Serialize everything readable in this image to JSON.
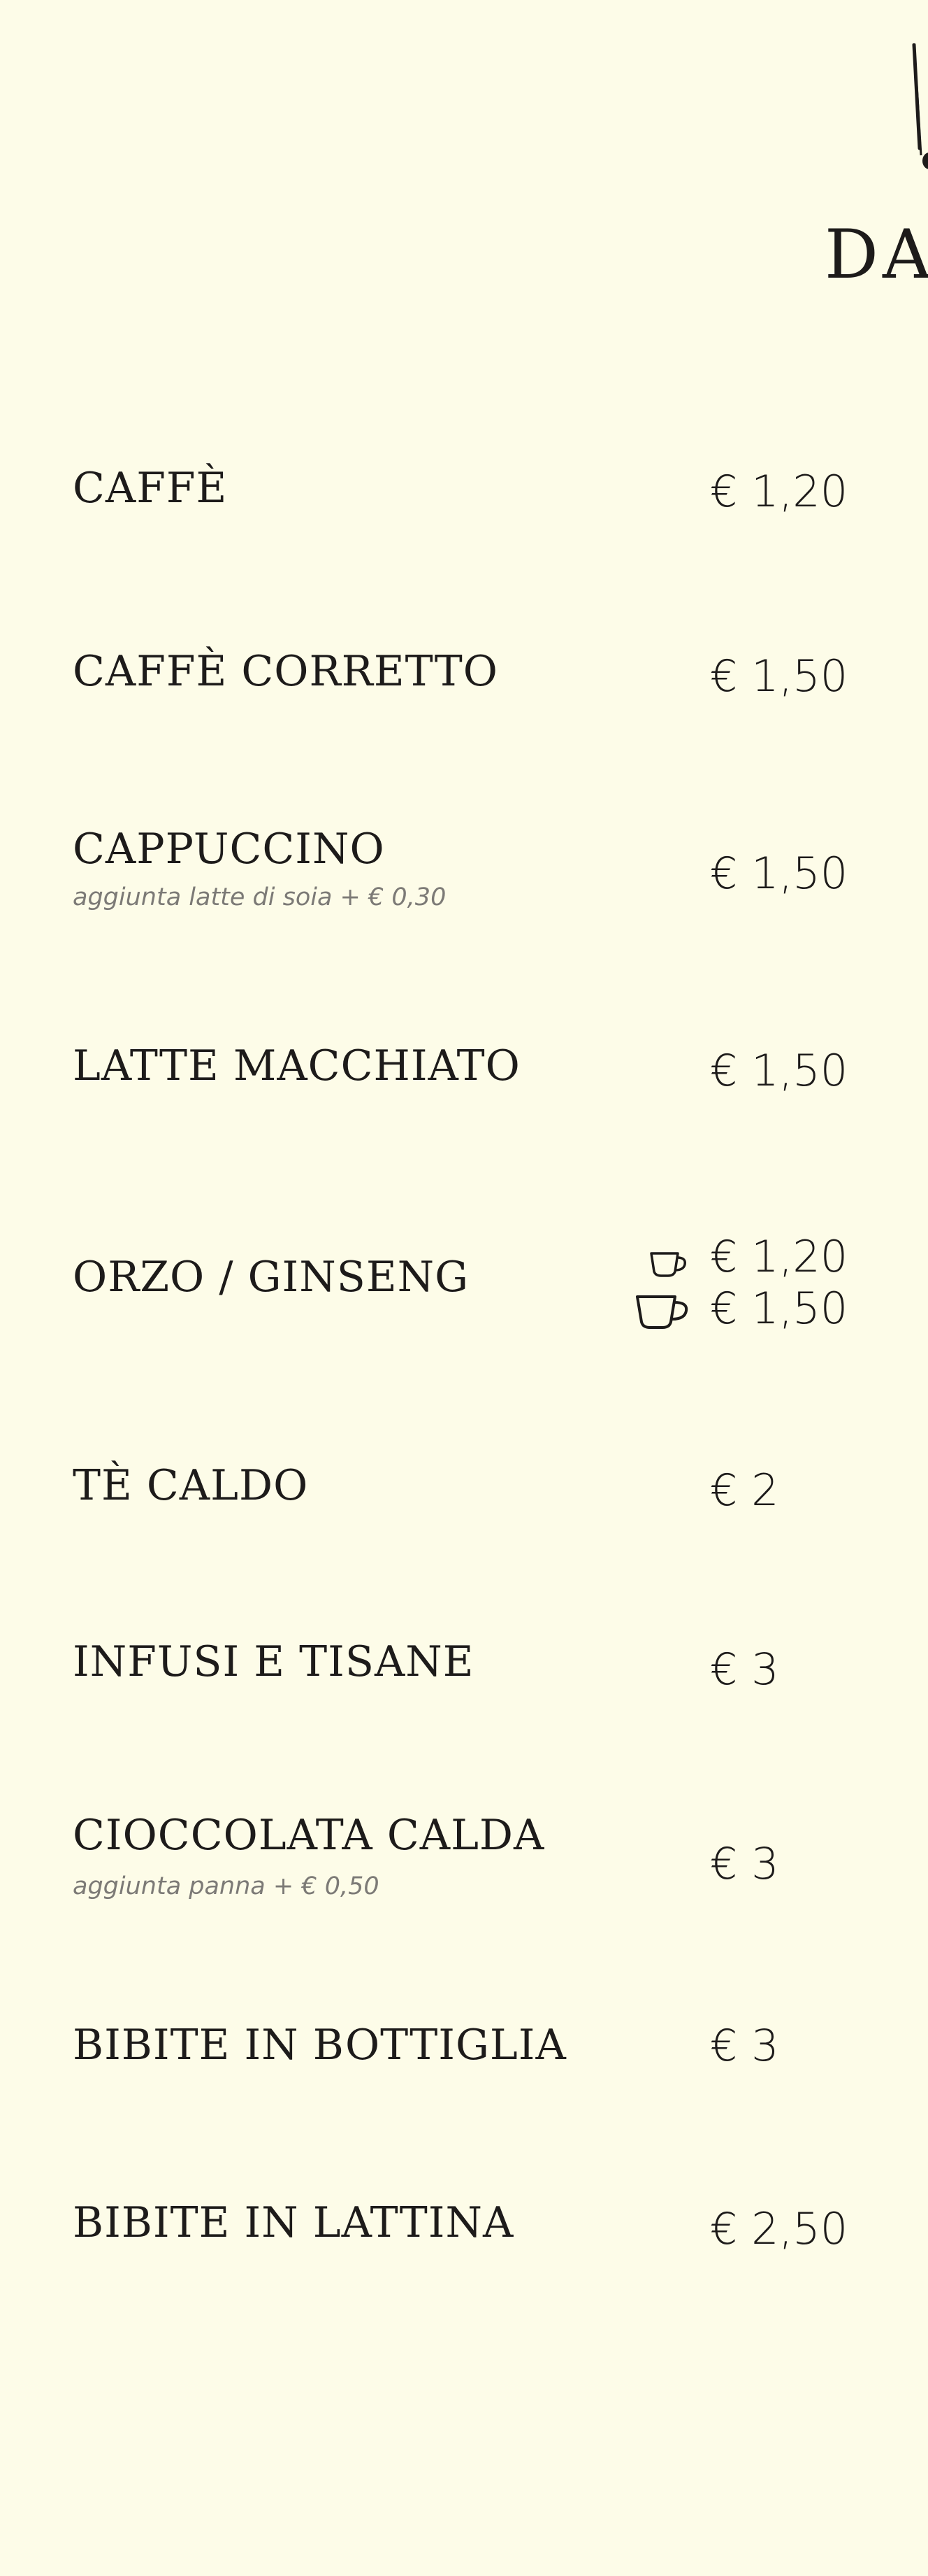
{
  "menu": {
    "section_title": "DA",
    "items": [
      {
        "name": "CAFFÈ",
        "note": "",
        "price": "€ 1,20"
      },
      {
        "name": "CAFFÈ CORRETTO",
        "note": "",
        "price": "€ 1,50"
      },
      {
        "name": "CAPPUCCINO",
        "note": "aggiunta latte di soia + € 0,30",
        "price": "€ 1,50"
      },
      {
        "name": "LATTE MACCHIATO",
        "note": "",
        "price": "€ 1,50"
      },
      {
        "name": "ORZO / GINSENG",
        "note": "",
        "price_small": "€ 1,20",
        "price_large": "€ 1,50",
        "small_icon": "small-cup-icon",
        "large_icon": "large-cup-icon"
      },
      {
        "name": "TÈ CALDO",
        "note": "",
        "price": "€ 2"
      },
      {
        "name": "INFUSI E TISANE",
        "note": "",
        "price": "€ 3"
      },
      {
        "name": "CIOCCOLATA CALDA",
        "note": "aggiunta panna + € 0,50",
        "price": "€ 3"
      },
      {
        "name": "BIBITE IN BOTTIGLIA",
        "note": "",
        "price": "€ 3"
      },
      {
        "name": "BIBITE IN LATTINA",
        "note": "",
        "price": "€ 2,50"
      }
    ]
  },
  "colors": {
    "background": "#fdfce8",
    "text": "#1d1b1a",
    "note": "#7c7a76"
  },
  "icons": {
    "header": "spoon-icon"
  }
}
